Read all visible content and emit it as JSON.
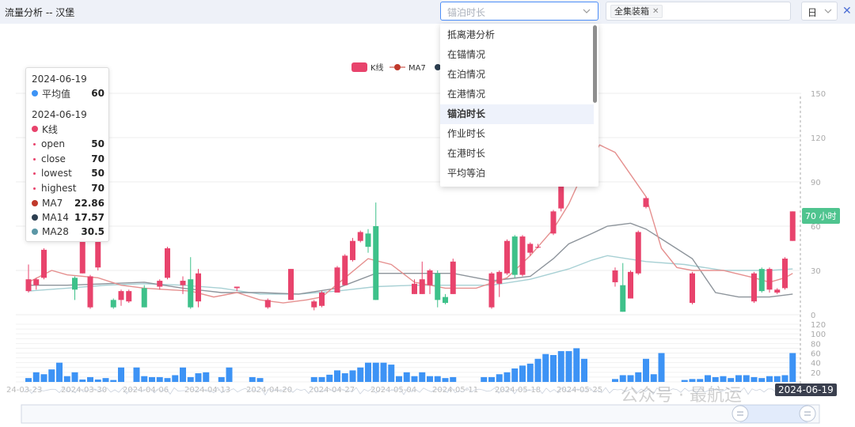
{
  "header": {
    "title": "流量分析 -- 汉堡",
    "metric_placeholder": "锚泊时长",
    "cargo_tag": "全集装箱",
    "period": "日"
  },
  "dropdown": {
    "items": [
      "抵离港分析",
      "在锚情况",
      "在泊情况",
      "在港情况",
      "锚泊时长",
      "作业时长",
      "在港时长",
      "平均等泊"
    ],
    "selected": "锚泊时长"
  },
  "legend": {
    "kline": "K线",
    "ma7": "MA7"
  },
  "tooltip": {
    "date1": "2024-06-19",
    "avg_label": "平均值",
    "avg_value": "60",
    "date2": "2024-06-19",
    "kline_label": "K线",
    "open_label": "open",
    "open_value": "50",
    "close_label": "close",
    "close_value": "70",
    "lowest_label": "lowest",
    "lowest_value": "50",
    "highest_label": "highest",
    "highest_value": "70",
    "ma7_label": "MA7",
    "ma7_value": "22.86",
    "ma14_label": "MA14",
    "ma14_value": "17.57",
    "ma28_label": "MA28",
    "ma28_value": "30.5"
  },
  "cursor": {
    "date": "2024-06-19",
    "value_label": "70 小时"
  },
  "watermark": "公众号 · 最航运",
  "colors": {
    "up": "#e8436c",
    "down": "#3ec18a",
    "ma7": "#e5908f",
    "ma14": "#8d949b",
    "ma28": "#a7d0d4",
    "volume": "#3d93f5"
  },
  "chart_data": {
    "type": "candlestick",
    "y_axis": {
      "ticks": [
        "0",
        "30",
        "60",
        "90",
        "120",
        "150"
      ],
      "range": [
        0,
        150
      ]
    },
    "volume_axis": {
      "ticks": [
        "20",
        "40",
        "60",
        "80",
        "100",
        "120"
      ],
      "range": [
        0,
        120
      ]
    },
    "x_ticks": [
      "24-03-23",
      "2024-03-30",
      "2024-04-06",
      "2024-04-13",
      "2024-04-20",
      "2024-04-27",
      "2024-05-04",
      "2024-05-11",
      "2024-05-18",
      "2024-05-25"
    ],
    "candles": [
      [
        0,
        16,
        24,
        15,
        34
      ],
      [
        1,
        20,
        24,
        17,
        25
      ],
      [
        2,
        25,
        44,
        24,
        45
      ],
      [
        6,
        25,
        17,
        10,
        26
      ],
      [
        7,
        28,
        52,
        28,
        54
      ],
      [
        8,
        5,
        26,
        4,
        27
      ],
      [
        9,
        32,
        52,
        30,
        54
      ],
      [
        11,
        10,
        5,
        4,
        11
      ],
      [
        12,
        10,
        16,
        6,
        17
      ],
      [
        13,
        9,
        16,
        8,
        17
      ],
      [
        15,
        18,
        5,
        5,
        20
      ],
      [
        17,
        19,
        23,
        17,
        24
      ],
      [
        18,
        25,
        45,
        24,
        46
      ],
      [
        20,
        20,
        23,
        14,
        26
      ],
      [
        21,
        24,
        5,
        4,
        39
      ],
      [
        22,
        9,
        28,
        5,
        31
      ],
      [
        27,
        18,
        19,
        16,
        19
      ],
      [
        31,
        5,
        10,
        4,
        11
      ],
      [
        34,
        10,
        31,
        10,
        31
      ],
      [
        37,
        5,
        9,
        3,
        10
      ],
      [
        38,
        6,
        15,
        5,
        16
      ],
      [
        40,
        15,
        32,
        15,
        33
      ],
      [
        41,
        20,
        40,
        20,
        41
      ],
      [
        42,
        37,
        50,
        36,
        52
      ],
      [
        43,
        50,
        56,
        49,
        57
      ],
      [
        44,
        55,
        46,
        42,
        58
      ],
      [
        45,
        60,
        10,
        10,
        76
      ],
      [
        50,
        14,
        21,
        14,
        24
      ],
      [
        51,
        14,
        24,
        14,
        36
      ],
      [
        52,
        20,
        30,
        14,
        31
      ],
      [
        53,
        28,
        10,
        5,
        30
      ],
      [
        54,
        12,
        8,
        7,
        14
      ],
      [
        55,
        14,
        36,
        14,
        38
      ],
      [
        60,
        5,
        28,
        4,
        29
      ],
      [
        61,
        21,
        29,
        12,
        30
      ],
      [
        62,
        28,
        50,
        27,
        51
      ],
      [
        63,
        53,
        27,
        25,
        54
      ],
      [
        64,
        27,
        53,
        26,
        54
      ],
      [
        65,
        42,
        48,
        40,
        49
      ],
      [
        66,
        46,
        46,
        45,
        48
      ],
      [
        68,
        55,
        70,
        54,
        71
      ],
      [
        69,
        72,
        99,
        70,
        101
      ],
      [
        70,
        110,
        132,
        108,
        136
      ],
      [
        76,
        22,
        30,
        19,
        32
      ],
      [
        77,
        20,
        2,
        2,
        35
      ],
      [
        78,
        11,
        29,
        11,
        30
      ],
      [
        79,
        28,
        56,
        27,
        57
      ],
      [
        80,
        73,
        79,
        72,
        80
      ],
      [
        86,
        8,
        28,
        7,
        29
      ],
      [
        94,
        9,
        28,
        8,
        29
      ],
      [
        95,
        31,
        16,
        15,
        32
      ],
      [
        96,
        17,
        31,
        15,
        32
      ],
      [
        97,
        15,
        17,
        14,
        18
      ],
      [
        98,
        18,
        38,
        17,
        39
      ],
      [
        99,
        50,
        70,
        50,
        70
      ]
    ],
    "volume": [
      [
        0,
        8
      ],
      [
        1,
        20
      ],
      [
        2,
        16
      ],
      [
        3,
        26
      ],
      [
        4,
        40
      ],
      [
        5,
        12
      ],
      [
        6,
        20
      ],
      [
        7,
        5
      ],
      [
        8,
        10
      ],
      [
        9,
        5
      ],
      [
        10,
        8
      ],
      [
        11,
        4
      ],
      [
        12,
        30
      ],
      [
        14,
        30
      ],
      [
        15,
        12
      ],
      [
        16,
        10
      ],
      [
        17,
        10
      ],
      [
        18,
        8
      ],
      [
        19,
        14
      ],
      [
        20,
        30
      ],
      [
        21,
        10
      ],
      [
        22,
        18
      ],
      [
        23,
        20
      ],
      [
        25,
        10
      ],
      [
        26,
        30
      ],
      [
        29,
        10
      ],
      [
        30,
        8
      ],
      [
        37,
        10
      ],
      [
        38,
        10
      ],
      [
        39,
        15
      ],
      [
        40,
        24
      ],
      [
        41,
        18
      ],
      [
        42,
        24
      ],
      [
        43,
        30
      ],
      [
        44,
        40
      ],
      [
        45,
        40
      ],
      [
        46,
        40
      ],
      [
        47,
        36
      ],
      [
        48,
        12
      ],
      [
        49,
        20
      ],
      [
        50,
        12
      ],
      [
        51,
        20
      ],
      [
        52,
        12
      ],
      [
        53,
        12
      ],
      [
        54,
        8
      ],
      [
        55,
        10
      ],
      [
        59,
        10
      ],
      [
        60,
        10
      ],
      [
        61,
        16
      ],
      [
        62,
        20
      ],
      [
        63,
        28
      ],
      [
        64,
        34
      ],
      [
        65,
        38
      ],
      [
        66,
        48
      ],
      [
        67,
        58
      ],
      [
        68,
        56
      ],
      [
        69,
        64
      ],
      [
        70,
        64
      ],
      [
        71,
        70
      ],
      [
        72,
        48
      ],
      [
        76,
        6
      ],
      [
        77,
        14
      ],
      [
        78,
        14
      ],
      [
        79,
        20
      ],
      [
        80,
        48
      ],
      [
        81,
        16
      ],
      [
        82,
        60
      ],
      [
        85,
        4
      ],
      [
        86,
        6
      ],
      [
        87,
        6
      ],
      [
        88,
        14
      ],
      [
        89,
        10
      ],
      [
        90,
        12
      ],
      [
        91,
        8
      ],
      [
        92,
        14
      ],
      [
        93,
        14
      ],
      [
        94,
        10
      ],
      [
        95,
        8
      ],
      [
        96,
        12
      ],
      [
        97,
        12
      ],
      [
        98,
        14
      ],
      [
        99,
        60
      ]
    ],
    "ma7": [
      [
        0,
        22
      ],
      [
        3,
        30
      ],
      [
        5,
        27
      ],
      [
        9,
        25
      ],
      [
        12,
        20
      ],
      [
        15,
        18
      ],
      [
        18,
        17
      ],
      [
        21,
        16
      ],
      [
        24,
        12
      ],
      [
        27,
        15
      ],
      [
        30,
        10
      ],
      [
        33,
        8
      ],
      [
        36,
        10
      ],
      [
        38,
        12
      ],
      [
        41,
        25
      ],
      [
        44,
        38
      ],
      [
        47,
        34
      ],
      [
        50,
        22
      ],
      [
        54,
        18
      ],
      [
        58,
        18
      ],
      [
        62,
        25
      ],
      [
        65,
        40
      ],
      [
        68,
        58
      ],
      [
        70,
        75
      ],
      [
        72,
        98
      ],
      [
        74,
        115
      ],
      [
        76,
        110
      ],
      [
        78,
        95
      ],
      [
        80,
        80
      ],
      [
        82,
        45
      ],
      [
        84,
        32
      ],
      [
        86,
        30
      ],
      [
        90,
        30
      ],
      [
        94,
        25
      ],
      [
        96,
        22
      ],
      [
        98,
        25
      ],
      [
        99,
        28
      ]
    ],
    "ma14": [
      [
        0,
        20
      ],
      [
        5,
        20
      ],
      [
        10,
        21
      ],
      [
        15,
        22
      ],
      [
        20,
        18
      ],
      [
        25,
        15
      ],
      [
        30,
        15
      ],
      [
        35,
        14
      ],
      [
        40,
        18
      ],
      [
        45,
        28
      ],
      [
        50,
        28
      ],
      [
        55,
        28
      ],
      [
        60,
        23
      ],
      [
        65,
        26
      ],
      [
        68,
        38
      ],
      [
        70,
        48
      ],
      [
        73,
        55
      ],
      [
        75,
        60
      ],
      [
        78,
        62
      ],
      [
        80,
        58
      ],
      [
        83,
        48
      ],
      [
        86,
        38
      ],
      [
        89,
        15
      ],
      [
        92,
        12
      ],
      [
        96,
        12
      ],
      [
        99,
        14
      ]
    ],
    "ma28": [
      [
        0,
        16
      ],
      [
        5,
        18
      ],
      [
        10,
        20
      ],
      [
        15,
        21
      ],
      [
        20,
        20
      ],
      [
        25,
        18
      ],
      [
        30,
        14
      ],
      [
        35,
        14
      ],
      [
        40,
        16
      ],
      [
        45,
        19
      ],
      [
        50,
        20
      ],
      [
        55,
        20
      ],
      [
        60,
        20
      ],
      [
        65,
        24
      ],
      [
        70,
        31
      ],
      [
        73,
        37
      ],
      [
        75,
        40
      ],
      [
        80,
        36
      ],
      [
        85,
        34
      ],
      [
        90,
        30
      ],
      [
        96,
        30
      ],
      [
        99,
        31
      ]
    ]
  }
}
